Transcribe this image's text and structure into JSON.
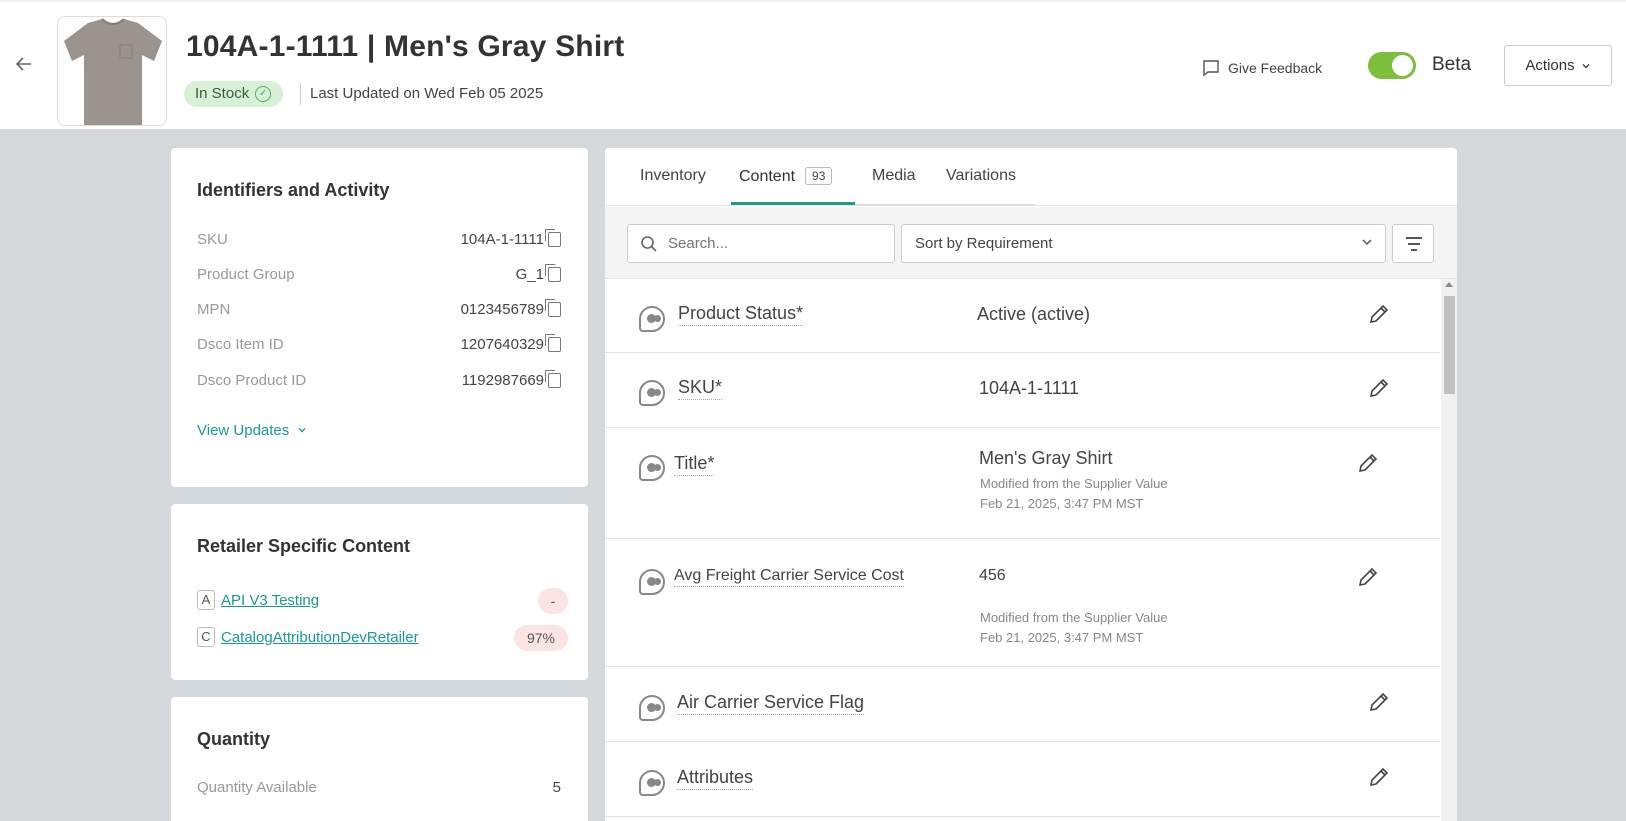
{
  "header": {
    "title": "104A-1-1111 | Men's Gray Shirt",
    "stock_status": "In Stock",
    "last_updated": "Last Updated on Wed Feb 05 2025",
    "feedback_label": "Give Feedback",
    "beta_label": "Beta",
    "actions_label": "Actions"
  },
  "identifiers": {
    "heading": "Identifiers and Activity",
    "rows": [
      {
        "label": "SKU",
        "value": "104A-1-1111"
      },
      {
        "label": "Product Group",
        "value": "G_1"
      },
      {
        "label": "MPN",
        "value": "0123456789"
      },
      {
        "label": "Dsco Item ID",
        "value": "1207640329"
      },
      {
        "label": "Dsco Product ID",
        "value": "1192987669"
      }
    ],
    "view_updates": "View Updates"
  },
  "retailer": {
    "heading": "Retailer Specific Content",
    "items": [
      {
        "letter": "A",
        "name": "API V3 Testing",
        "score": "-"
      },
      {
        "letter": "C",
        "name": "CatalogAttributionDevRetailer",
        "score": "97%"
      }
    ]
  },
  "quantity": {
    "heading": "Quantity",
    "label": "Quantity Available",
    "value": "5"
  },
  "tabs": [
    {
      "label": "Inventory"
    },
    {
      "label": "Content",
      "badge": "93"
    },
    {
      "label": "Media"
    },
    {
      "label": "Variations"
    }
  ],
  "toolbar": {
    "search_placeholder": "Search...",
    "sort_value": "Sort by Requirement"
  },
  "attributes": [
    {
      "label": "Product Status*",
      "value": "Active (active)"
    },
    {
      "label": "SKU*",
      "value": "104A-1-1111"
    },
    {
      "label": "Title*",
      "value": "Men's Gray Shirt",
      "sub1": "Modified from the Supplier Value",
      "sub2": "Feb 21, 2025, 3:47 PM MST"
    },
    {
      "label": "Avg Freight Carrier Service Cost",
      "value": "456",
      "sub1": "Modified from the Supplier Value",
      "sub2": "Feb 21, 2025, 3:47 PM MST"
    },
    {
      "label": "Air Carrier Service Flag",
      "value": ""
    },
    {
      "label": "Attributes",
      "value": ""
    }
  ],
  "colors": {
    "accent": "#1a9a8f",
    "toggle_on": "#7bbf3c",
    "in_stock_bg": "#d9f0d8"
  }
}
